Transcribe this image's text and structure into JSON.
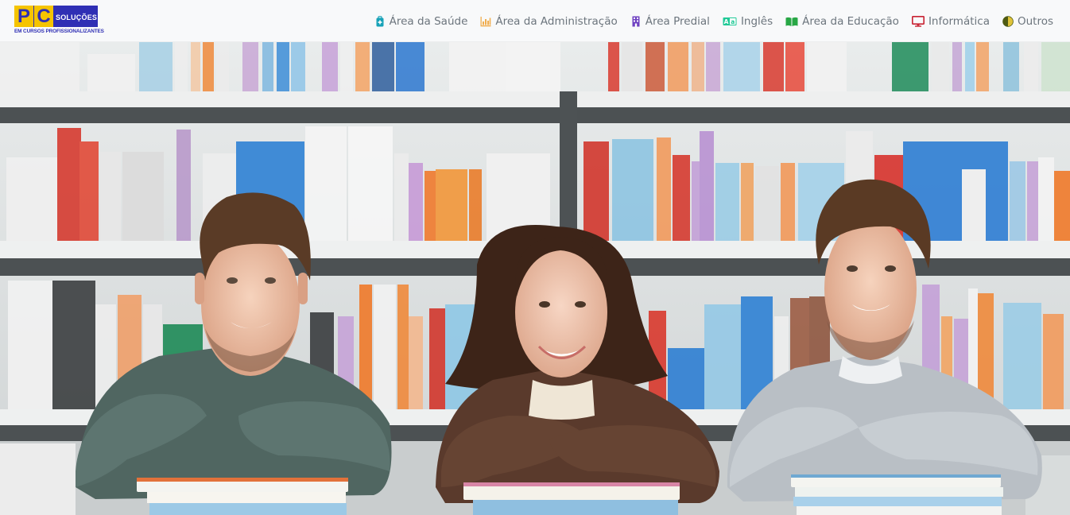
{
  "logo": {
    "letters": [
      "P",
      "C"
    ],
    "brand": "SOLUÇÕES",
    "tagline": "EM CURSOS PROFISSIONALIZANTES",
    "colors": {
      "blue": "#2f2fb4",
      "yellow": "#f5c400"
    }
  },
  "nav": {
    "items": [
      {
        "label": "Área da Saúde",
        "icon": "medkit-icon",
        "color": "#17a2b8"
      },
      {
        "label": "Área da Administração",
        "icon": "bar-chart-icon",
        "color": "#f0ad4e"
      },
      {
        "label": "Área Predial",
        "icon": "building-icon",
        "color": "#6f42c1"
      },
      {
        "label": "Inglês",
        "icon": "language-icon",
        "color": "#20c997"
      },
      {
        "label": "Área da Educação",
        "icon": "book-icon",
        "color": "#28a745"
      },
      {
        "label": "Informática",
        "icon": "desktop-icon",
        "color": "#c82333"
      },
      {
        "label": "Outros",
        "icon": "adjust-icon",
        "color": "#4e5a12"
      }
    ]
  },
  "hero": {
    "subject": "three smiling students leaning on stacks of books in front of library shelves"
  }
}
